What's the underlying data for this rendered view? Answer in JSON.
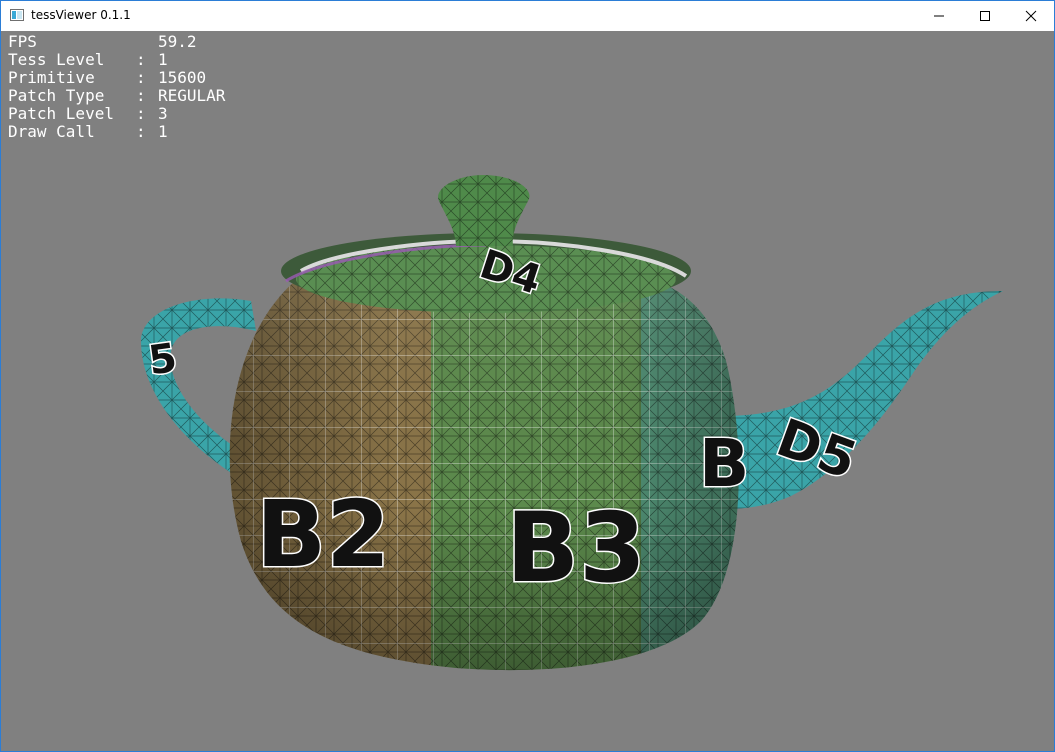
{
  "window": {
    "title": "tessViewer 0.1.1",
    "controls": {
      "minimize": "minimize",
      "maximize": "maximize",
      "close": "close"
    }
  },
  "stats": [
    {
      "key": "FPS",
      "sep": "",
      "value": "59.2"
    },
    {
      "key": "Tess Level",
      "sep": ":",
      "value": "1"
    },
    {
      "key": "Primitive",
      "sep": ":",
      "value": "15600"
    },
    {
      "key": "Patch Type",
      "sep": ":",
      "value": "REGULAR"
    },
    {
      "key": "Patch Level",
      "sep": ":",
      "value": "3"
    },
    {
      "key": "Draw Call",
      "sep": ":",
      "value": "1"
    }
  ],
  "scene": {
    "model": "teapot",
    "patch_labels": {
      "body_left": "B2",
      "body_center": "B3",
      "body_right": "B",
      "lid": "D4",
      "handle": "5",
      "spout": "D5"
    },
    "colors": {
      "background": "#808080",
      "body_left": "#8a7448",
      "body_center": "#5c8a4c",
      "body_right": "#4f8d72",
      "spout": "#3aa4a8",
      "handle": "#3aa4a8",
      "lid": "#5a8e52"
    }
  }
}
